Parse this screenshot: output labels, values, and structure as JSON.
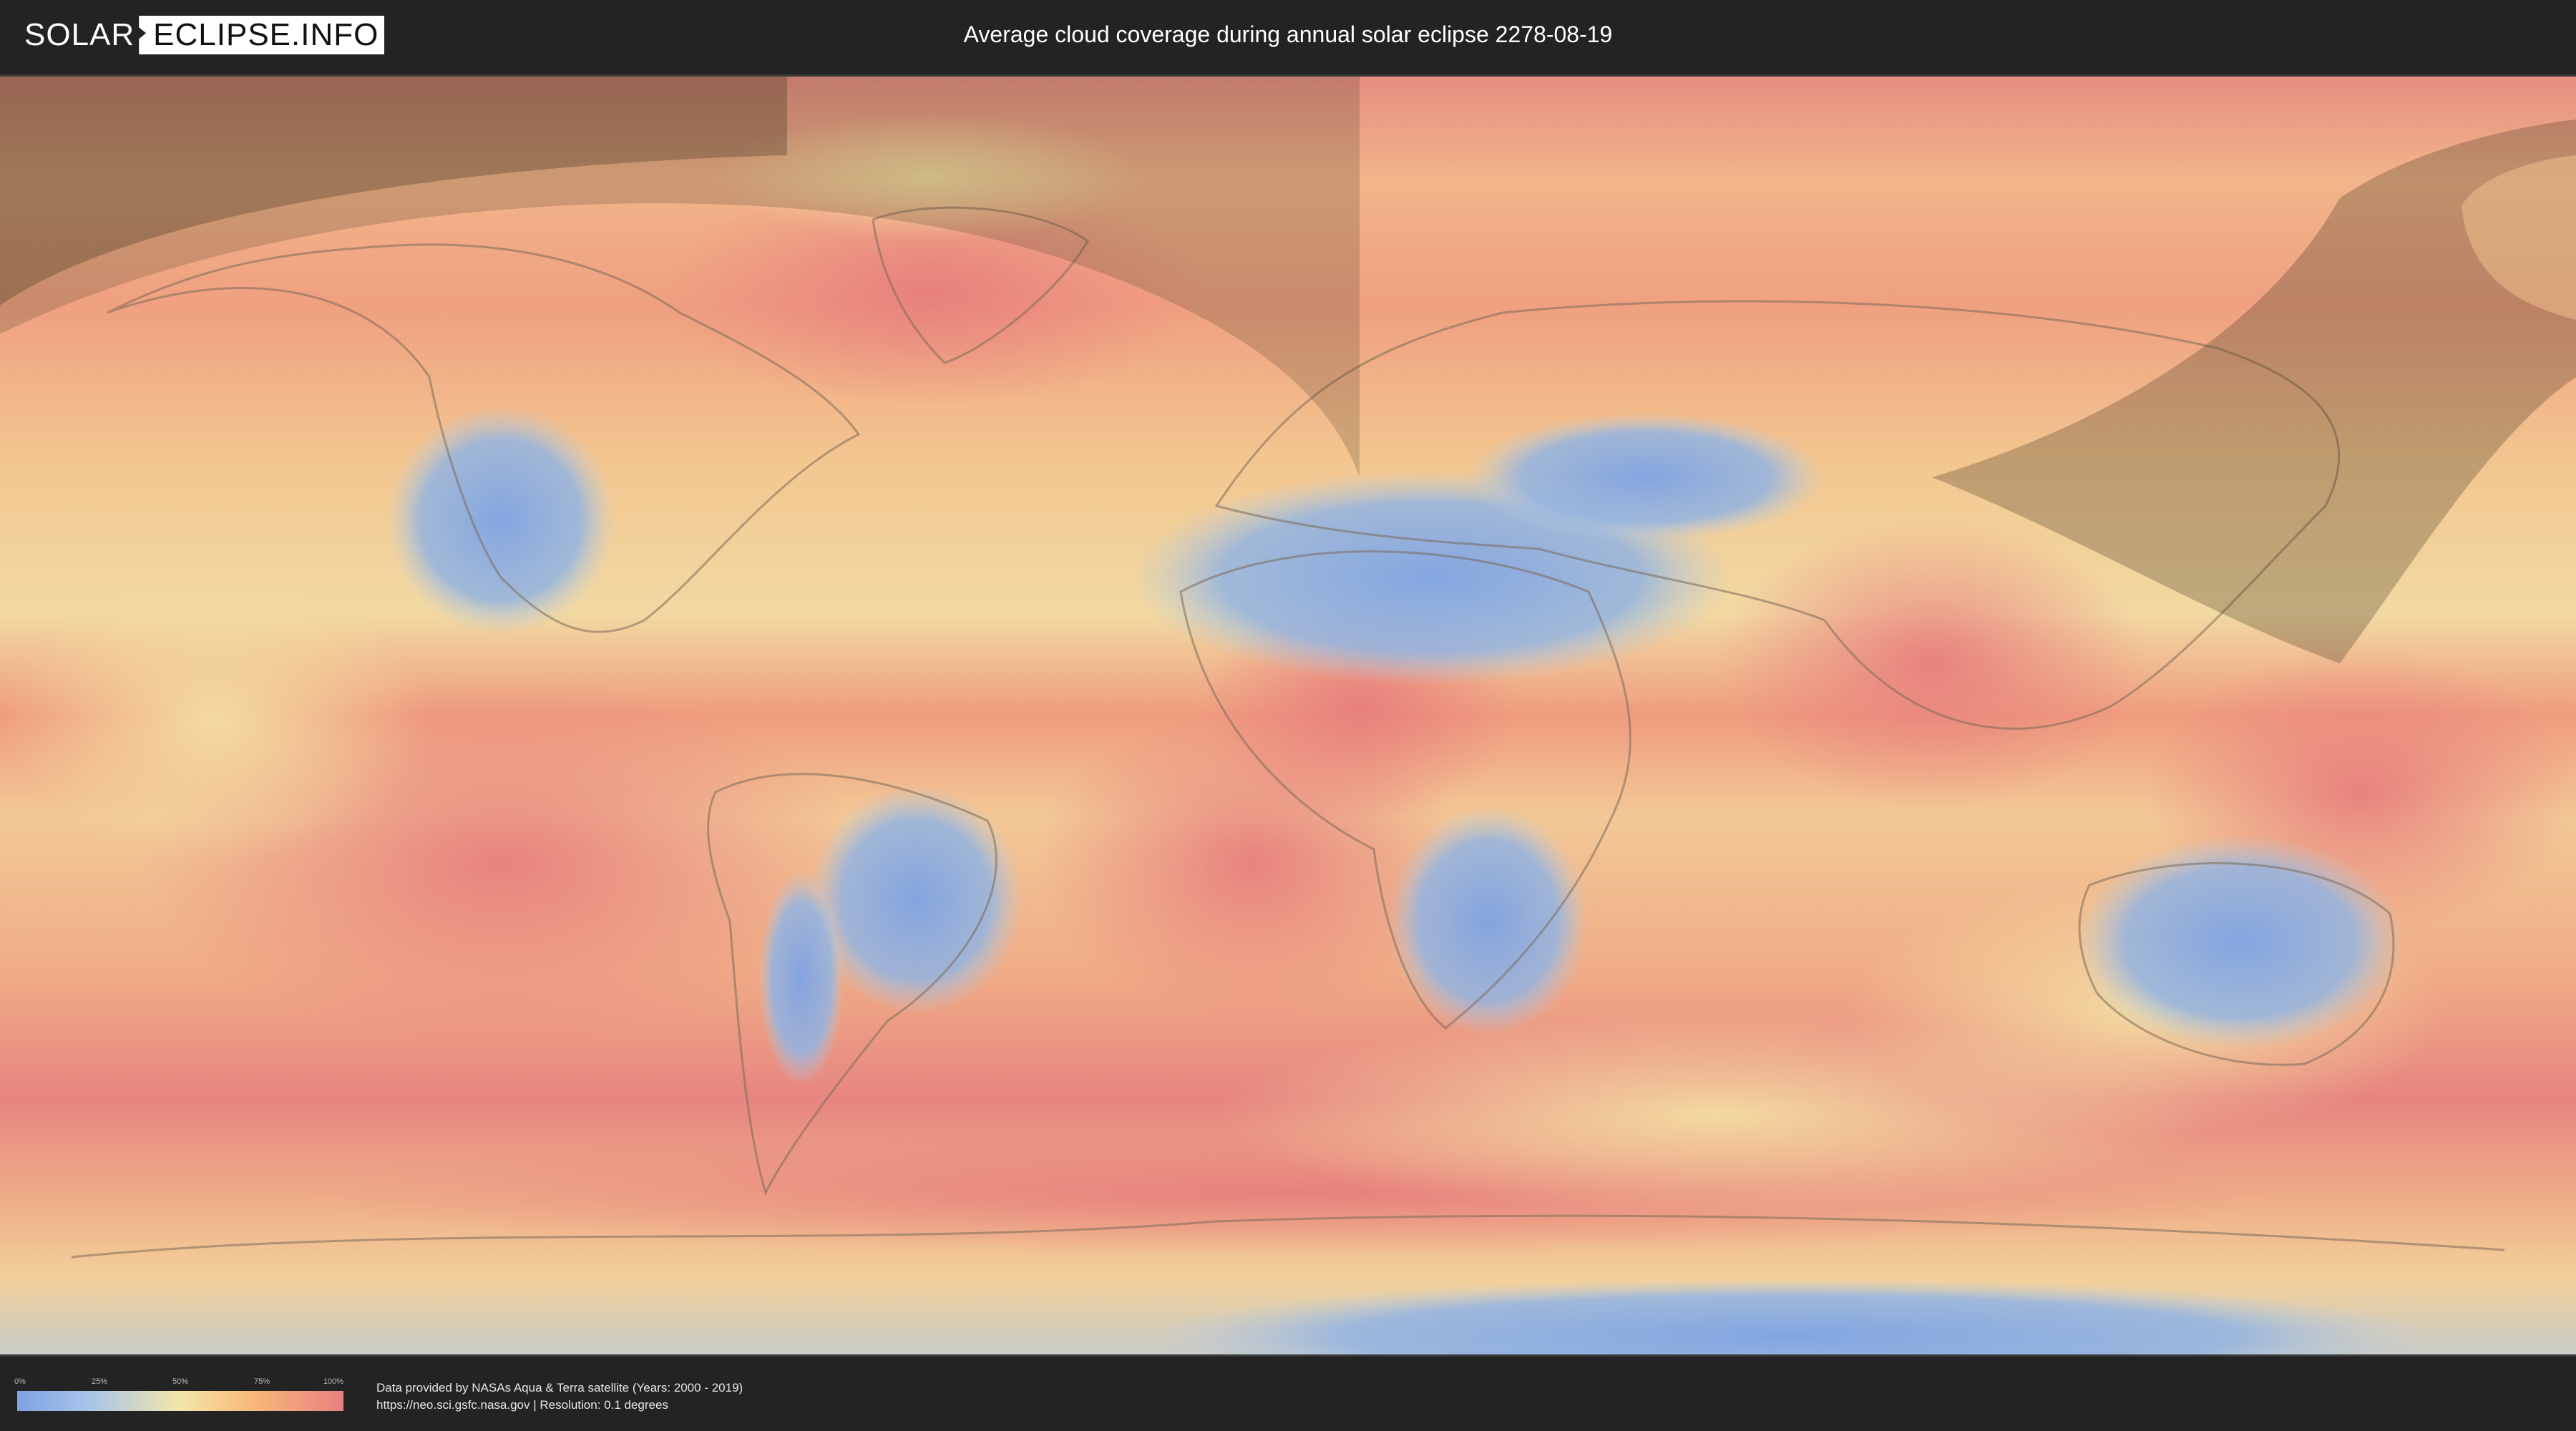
{
  "header": {
    "logo_left": "SOLAR",
    "logo_right": "ECLIPSE.INFO",
    "title": "Average cloud coverage during annual solar eclipse 2278-08-19"
  },
  "map": {
    "layer": "average cloud coverage",
    "colors": {
      "clear": "#7ea3e4",
      "mid": "#f4e6a8",
      "cloudy": "#e98080",
      "eclipse_overlay": "#4a3b24",
      "land_outline": "#7a6a5a"
    }
  },
  "legend": {
    "ticks": [
      "0%",
      "25%",
      "50%",
      "75%",
      "100%"
    ],
    "gradient_colors": [
      "#7ea3e4",
      "#a8c4e8",
      "#f4e6a8",
      "#f6b97a",
      "#e98080"
    ]
  },
  "footer": {
    "credit_line1": "Data provided by NASAs Aqua & Terra satellite (Years: 2000 - 2019)",
    "credit_line2": "https://neo.sci.gsfc.nasa.gov | Resolution: 0.1 degrees"
  }
}
